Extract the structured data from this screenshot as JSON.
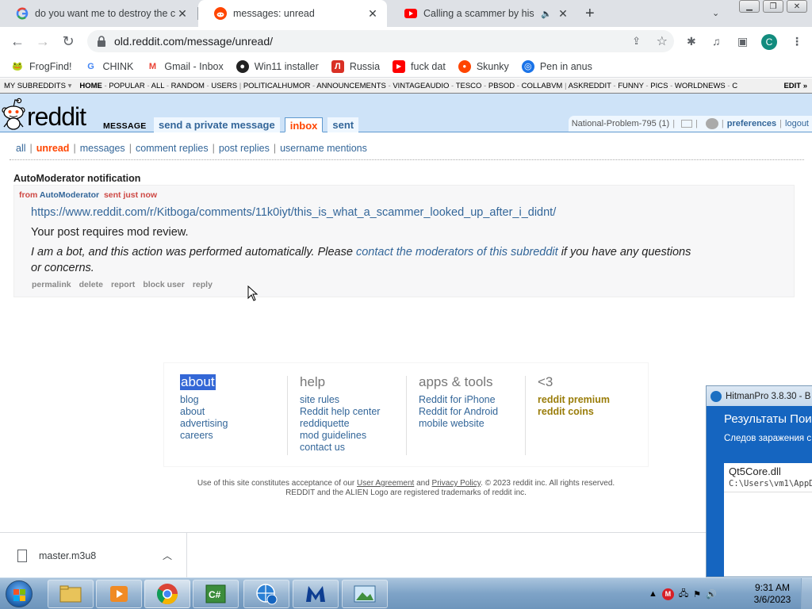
{
  "browser": {
    "tabs": [
      {
        "title": "do you want me to destroy the c",
        "favicon": "google-icon"
      },
      {
        "title": "messages: unread",
        "favicon": "reddit-icon"
      },
      {
        "title": "Calling a scammer by his rea",
        "favicon": "youtube-icon"
      }
    ],
    "url": "old.reddit.com/message/unread/",
    "profile_initial": "C",
    "bookmarks": [
      {
        "label": "FrogFind!",
        "icon": "frogfind-icon"
      },
      {
        "label": "CHINK",
        "icon": "google-icon"
      },
      {
        "label": "Gmail - Inbox",
        "icon": "gmail-icon"
      },
      {
        "label": "Win11 installer",
        "icon": "github-icon"
      },
      {
        "label": "Russia",
        "icon": "bookmark-red-icon"
      },
      {
        "label": "fuck dat",
        "icon": "youtube-icon"
      },
      {
        "label": "Skunky",
        "icon": "reddit-icon"
      },
      {
        "label": "Pen in anus",
        "icon": "globe-icon"
      }
    ]
  },
  "reddit": {
    "srbar": {
      "my_subreddits": "MY SUBREDDITS",
      "links": [
        "HOME",
        "POPULAR",
        "ALL",
        "RANDOM",
        "USERS",
        "POLITICALHUMOR",
        "ANNOUNCEMENTS",
        "VINTAGEAUDIO",
        "TESCO",
        "PBSOD",
        "COLLABVM",
        "ASKREDDIT",
        "FUNNY",
        "PICS",
        "WORLDNEWS",
        "C"
      ],
      "edit": "EDIT »"
    },
    "header": {
      "logo_text": "reddit",
      "page_name": "MESSAGE",
      "tabs": [
        "send a private message",
        "inbox",
        "sent"
      ],
      "username": "National-Problem-795",
      "karma": "(1)",
      "preferences": "preferences",
      "logout": "logout"
    },
    "menu": [
      "all",
      "unread",
      "messages",
      "comment replies",
      "post replies",
      "username mentions"
    ],
    "message": {
      "subject": "AutoModerator notification",
      "from_prefix": "from",
      "author": "AutoModerator",
      "sent": "sent just now",
      "link": "https://www.reddit.com/r/Kitboga/comments/11k0iyt/this_is_what_a_scammer_looked_up_after_i_didnt/",
      "body1": "Your post requires mod review.",
      "bot_pre": "I am a bot, and this action was performed automatically. Please ",
      "bot_link": "contact the moderators of this subreddit",
      "bot_post": " if you have any questions or concerns.",
      "actions": [
        "permalink",
        "delete",
        "report",
        "block user",
        "reply"
      ]
    },
    "footer": {
      "columns": [
        {
          "heading": "about",
          "links": [
            "blog",
            "about",
            "advertising",
            "careers"
          ]
        },
        {
          "heading": "help",
          "links": [
            "site rules",
            "Reddit help center",
            "reddiquette",
            "mod guidelines",
            "contact us"
          ]
        },
        {
          "heading": "apps & tools",
          "links": [
            "Reddit for iPhone",
            "Reddit for Android",
            "mobile website"
          ]
        },
        {
          "heading": "<3",
          "links": [
            "reddit premium",
            "reddit coins"
          ]
        }
      ],
      "legal_pre": "Use of this site constitutes acceptance of our ",
      "user_agreement": "User Agreement",
      "and": " and ",
      "privacy_policy": "Privacy Policy",
      "legal_post": ". © 2023 reddit inc. All rights reserved.",
      "legal_line2": "REDDIT and the ALIEN Logo are registered trademarks of reddit inc."
    }
  },
  "download": {
    "filename": "master.m3u8"
  },
  "hitmanpro": {
    "title": "HitmanPro 3.8.30 - B",
    "heading": "Результаты Пои",
    "subheading": "Следов заражения с",
    "file": "Qt5Core.dll",
    "path": "C:\\Users\\vm1\\AppDa"
  },
  "taskbar": {
    "time": "9:31 AM",
    "date": "3/6/2023"
  },
  "colors": {
    "reddit_orange": "#ff4500",
    "reddit_blue": "#cee3f8",
    "link_blue": "#336699",
    "hitman_blue": "#1565c0"
  }
}
